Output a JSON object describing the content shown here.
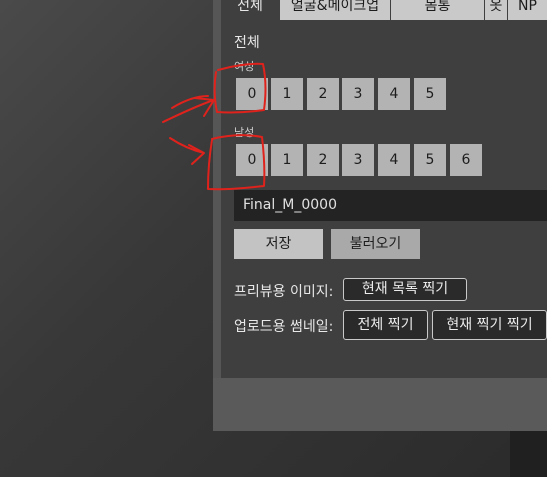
{
  "tabs": [
    {
      "label": "전체",
      "active": true
    },
    {
      "label": "얼굴&메이크업",
      "active": false
    },
    {
      "label": "몸통",
      "active": false
    },
    {
      "label": "옷",
      "active": false
    },
    {
      "label": "NP",
      "active": false
    }
  ],
  "section_title": "전체",
  "female": {
    "label": "여성",
    "slots": [
      "0",
      "1",
      "2",
      "3",
      "4",
      "5"
    ]
  },
  "male": {
    "label": "남성",
    "slots": [
      "0",
      "1",
      "2",
      "3",
      "4",
      "5",
      "6"
    ]
  },
  "name_field_value": "Final_M_0000",
  "buttons": {
    "save": "저장",
    "load": "불러오기"
  },
  "preview_image": {
    "label": "프리뷰용 이미지:",
    "button": "현재 목록 찍기"
  },
  "upload_thumbnail": {
    "label": "업로드용 썸네일:",
    "all_button": "전체 찍기",
    "current_button": "현재 찍기 찍기"
  },
  "colors": {
    "annotation": "#e0221c",
    "panel": "#3f3f3f"
  }
}
